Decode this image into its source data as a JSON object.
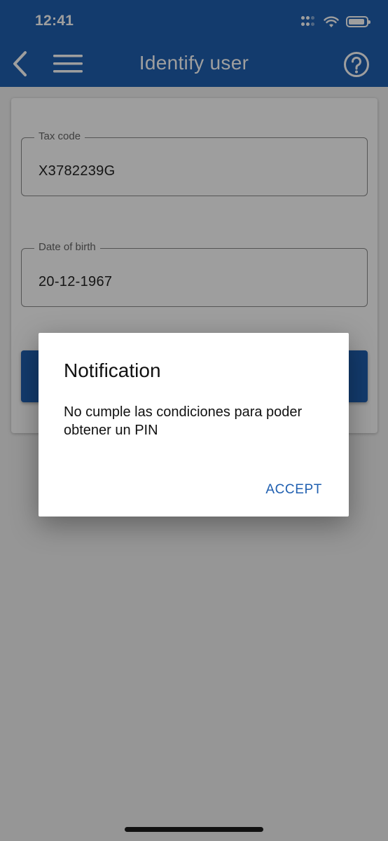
{
  "status_bar": {
    "time": "12:41"
  },
  "nav": {
    "title": "Identify user",
    "icons": {
      "back": "chevron-left-icon",
      "menu": "hamburger-menu-icon",
      "help": "help-circle-icon"
    }
  },
  "form": {
    "tax_code": {
      "label": "Tax code",
      "value": "X3782239G"
    },
    "date_of_birth": {
      "label": "Date of birth",
      "value": "20-12-1967"
    }
  },
  "dialog": {
    "title": "Notification",
    "message": "No cumple las condiciones para poder obtener un PIN",
    "accept_label": "ACCEPT"
  },
  "colors": {
    "primary": "#1f5fb0",
    "accent_text": "#1f5fb0"
  }
}
